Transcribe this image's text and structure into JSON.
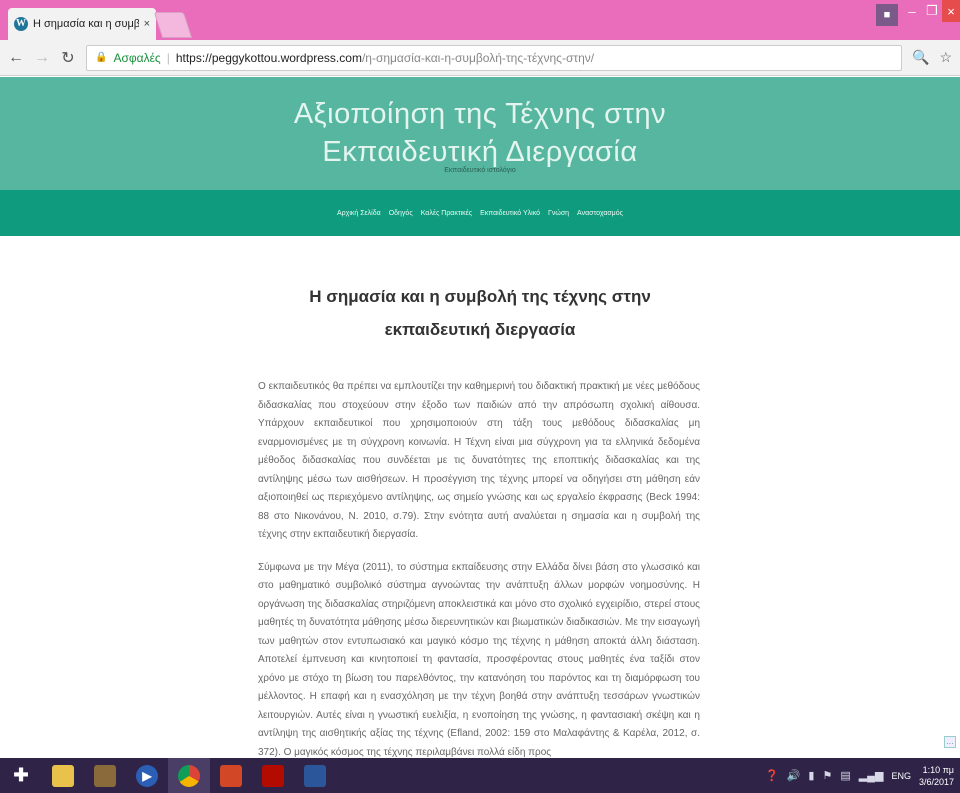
{
  "browser": {
    "tab_title": "Η σημασία και η συμβολ",
    "tab_close": "×",
    "secure_label": "Ασφαλές",
    "url_host": "https://peggykottou.wordpress.com",
    "url_path": "/η-σημασία-και-η-συμβολή-της-τέχνης-στην/"
  },
  "site": {
    "title_line1": "Αξιοποίηση της Τέχνης στην",
    "title_line2": "Εκπαιδευτική Διεργασία",
    "tagline": "Εκπαιδευτικό ιστολόγιο",
    "nav": [
      "Αρχική Σελίδα",
      "Οδηγός",
      "Καλές Πρακτικές",
      "Εκπαιδευτικό Υλικό",
      "Γνώση",
      "Αναστοχασμός"
    ]
  },
  "article": {
    "title_line1": "Η σημασία και η συμβολή της τέχνης στην",
    "title_line2": "εκπαιδευτική διεργασία",
    "paragraphs": [
      "Ο εκπαιδευτικός θα πρέπει να εμπλουτίζει την καθημερινή του διδακτική πρακτική με νέες μεθόδους διδασκαλίας που στοχεύουν στην έξοδο των παιδιών από την απρόσωπη σχολική αίθουσα. Υπάρχουν εκπαιδευτικοί που χρησιμοποιούν στη τάξη τους μεθόδους διδασκαλίας μη εναρμονισμένες με τη σύγχρονη κοινωνία. Η Τέχνη είναι μια σύγχρονη για τα ελληνικά δεδομένα μέθοδος διδασκαλίας που συνδέεται με τις δυνατότητες της εποπτικής διδασκαλίας και της αντίληψης μέσω των αισθήσεων. Η προσέγγιση της τέχνης μπορεί να οδηγήσει στη μάθηση εάν αξιοποιηθεί ως περιεχόμενο αντίληψης, ως σημείο γνώσης και ως εργαλείο έκφρασης (Beck 1994: 88 στο Νικονάνου, Ν. 2010, σ.79). Στην ενότητα αυτή αναλύεται η σημασία και η συμβολή της τέχνης στην εκπαιδευτική διεργασία.",
      "Σύμφωνα με την Μέγα (2011), το σύστημα εκπαίδευσης στην Ελλάδα δίνει βάση στο γλωσσικό και στο μαθηματικό συμβολικό σύστημα αγνοώντας την ανάπτυξη άλλων μορφών νοημοσύνης. Η οργάνωση της διδασκαλίας στηριζόμενη αποκλειστικά και μόνο στο σχολικό εγχειρίδιο, στερεί στους μαθητές τη δυνατότητα μάθησης μέσω διερευνητικών και βιωματικών διαδικασιών. Με την εισαγωγή των μαθητών στον εντυπωσιακό και μαγικό κόσμο της τέχνης η μάθηση αποκτά άλλη διάσταση. Αποτελεί έμπνευση και κινητοποιεί τη φαντασία, προσφέροντας στους μαθητές ένα ταξίδι στον χρόνο με στόχο τη βίωση του παρελθόντος, την κατανόηση του παρόντος και τη διαμόρφωση του μέλλοντος. Η επαφή και η ενασχόληση με την τέχνη βοηθά στην ανάπτυξη τεσσάρων γνωστικών λειτουργιών. Αυτές είναι η γνωστική ευελιξία, η ενοποίηση της γνώσης, η φαντασιακή σκέψη και η αντίληψη της αισθητικής αξίας της τέχνης (Efland, 2002: 159 στο Μαλαφάντης & Καρέλα, 2012, σ. 372). Ο μαγικός κόσμος της τέχνης περιλαμβάνει πολλά είδη προς"
    ]
  },
  "taskbar": {
    "language": "ENG",
    "time": "1:10 πμ",
    "date": "3/6/2017"
  }
}
